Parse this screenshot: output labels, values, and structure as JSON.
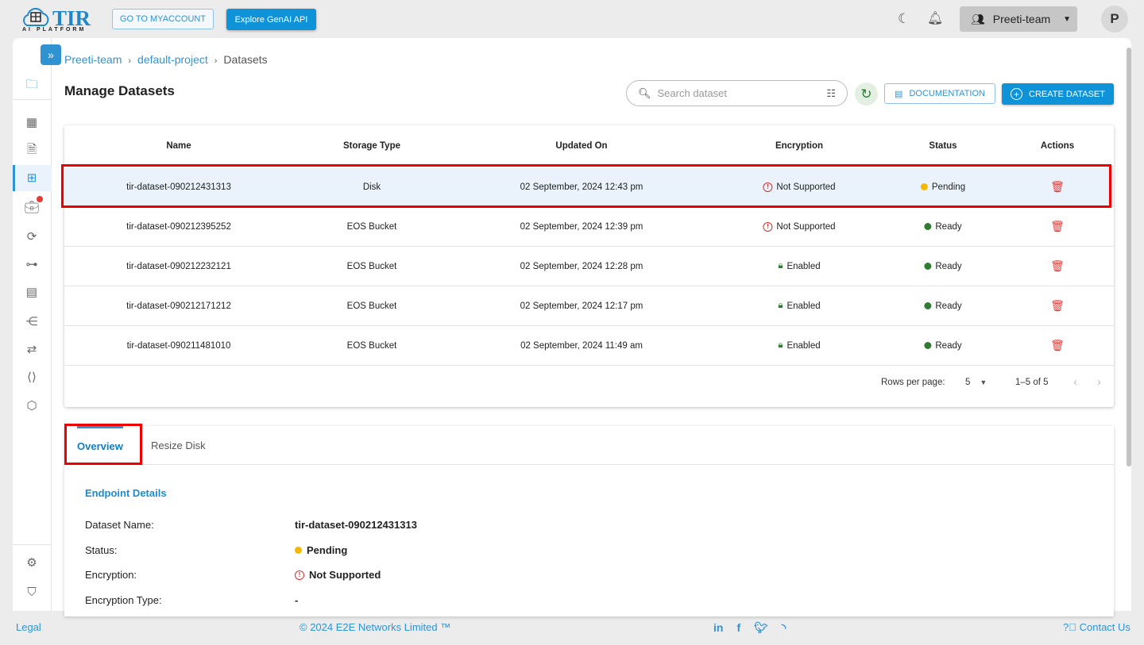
{
  "header": {
    "logo_text": "TIR",
    "logo_sub": "AI PLATFORM",
    "myaccount": "GO TO MYACCOUNT",
    "genai": "Explore GenAI API",
    "team": "Preeti-team",
    "avatar": "P"
  },
  "breadcrumb": [
    "Preeti-team",
    "default-project",
    "Datasets"
  ],
  "page": {
    "title": "Manage Datasets",
    "search_placeholder": "Search dataset",
    "documentation": "DOCUMENTATION",
    "create": "CREATE DATASET"
  },
  "table": {
    "columns": [
      "Name",
      "Storage Type",
      "Updated On",
      "Encryption",
      "Status",
      "Actions"
    ],
    "rows": [
      {
        "name": "tir-dataset-090212431313",
        "storage": "Disk",
        "updated": "02 September, 2024 12:43 pm",
        "encryption": "Not Supported",
        "status": "Pending"
      },
      {
        "name": "tir-dataset-090212395252",
        "storage": "EOS Bucket",
        "updated": "02 September, 2024 12:39 pm",
        "encryption": "Not Supported",
        "status": "Ready"
      },
      {
        "name": "tir-dataset-090212232121",
        "storage": "EOS Bucket",
        "updated": "02 September, 2024 12:28 pm",
        "encryption": "Enabled",
        "status": "Ready"
      },
      {
        "name": "tir-dataset-090212171212",
        "storage": "EOS Bucket",
        "updated": "02 September, 2024 12:17 pm",
        "encryption": "Enabled",
        "status": "Ready"
      },
      {
        "name": "tir-dataset-090211481010",
        "storage": "EOS Bucket",
        "updated": "02 September, 2024 11:49 am",
        "encryption": "Enabled",
        "status": "Ready"
      }
    ],
    "rows_per_page_label": "Rows per page:",
    "rows_per_page": "5",
    "range": "1–5 of 5"
  },
  "colors": {
    "accent": "#0f93d8",
    "pending": "#f5b800",
    "ready": "#2e7d32",
    "error": "#d32f2f"
  },
  "details": {
    "tabs": [
      "Overview",
      "Resize Disk"
    ],
    "section": "Endpoint Details",
    "fields": [
      {
        "label": "Dataset Name:",
        "value": "tir-dataset-090212431313"
      },
      {
        "label": "Status:",
        "value": "Pending"
      },
      {
        "label": "Encryption:",
        "value": "Not Supported"
      },
      {
        "label": "Encryption Type:",
        "value": "-"
      }
    ]
  },
  "footer": {
    "legal": "Legal",
    "copyright": "© 2024 E2E Networks Limited ™",
    "contact": "Contact Us"
  }
}
